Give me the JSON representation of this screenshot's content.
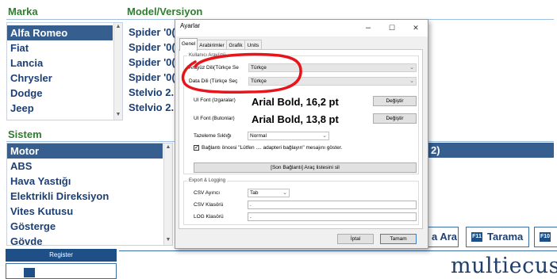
{
  "background": {
    "headers": {
      "marka": "Marka",
      "model": "Model/Versiyon",
      "sistem": "Sistem"
    },
    "brands": [
      "Alfa Romeo",
      "Fiat",
      "Lancia",
      "Chrysler",
      "Dodge",
      "Jeep"
    ],
    "models": [
      "Spider '0(",
      "Spider '0(",
      "Spider '0(",
      "Spider '0(",
      "Stelvio 2.",
      "Stelvio 2."
    ],
    "systems": [
      "Motor",
      "ABS",
      "Hava Yastığı",
      "Elektrikli Direksiyon",
      "Vites Kutusu",
      "Gösterge",
      "Gövde"
    ],
    "partial_right": "2)",
    "fkeys": [
      {
        "key": "",
        "label": "a Ara"
      },
      {
        "key": "F11",
        "label": "Tarama"
      },
      {
        "key": "F10",
        "label": ""
      }
    ],
    "register_label": "Register",
    "logo": "multiecus"
  },
  "dialog": {
    "title": "Ayarlar",
    "controls": {
      "minimize": "–",
      "maximize": "☐",
      "close": "✕"
    },
    "tabs": [
      "Genel",
      "Arabirimler",
      "Grafik",
      "Units"
    ],
    "active_tab": "Genel",
    "kullanici_arayuzu": {
      "group_title": "Kullanıcı Arayüzü",
      "interface_language_label": "Arayüz Dili(Türkçe Se",
      "interface_language_value": "Türkçe",
      "data_language_label": "Data Dili (Türkçe Seç",
      "data_language_value": "Türkçe",
      "ui_font_grid_label": "UI Font (Izgaralar)",
      "ui_font_grid_value": "Arial Bold, 16,2 pt",
      "ui_font_buttons_label": "UI Font (Butonlar)",
      "ui_font_buttons_value": "Arial Bold, 13,8 pt",
      "change_button": "Değiştir",
      "refresh_rate_label": "Tazeleme Sıklığı",
      "refresh_rate_value": "Normal",
      "connect_check_label": "Bağlantı öncesi \"Lütfen .... adapteri bağlayın\" mesajını göster.",
      "connect_check_checked": true,
      "clear_recent_button": "[Son Bağlantı] Araç listesini sil"
    },
    "export_logging": {
      "group_title": "Export & Logging",
      "csv_sep_label": "CSV Ayırıcı",
      "csv_sep_value": "Tab",
      "csv_folder_label": "CSV Klasörü",
      "csv_folder_value": ".",
      "log_folder_label": "LOG Klasörü",
      "log_folder_value": "."
    },
    "footer": {
      "cancel": "İptal",
      "ok": "Tamam"
    }
  },
  "colors": {
    "accent": "#1f4f87",
    "header_green": "#2f7d2f",
    "highlight_ring": "#e8141c"
  }
}
